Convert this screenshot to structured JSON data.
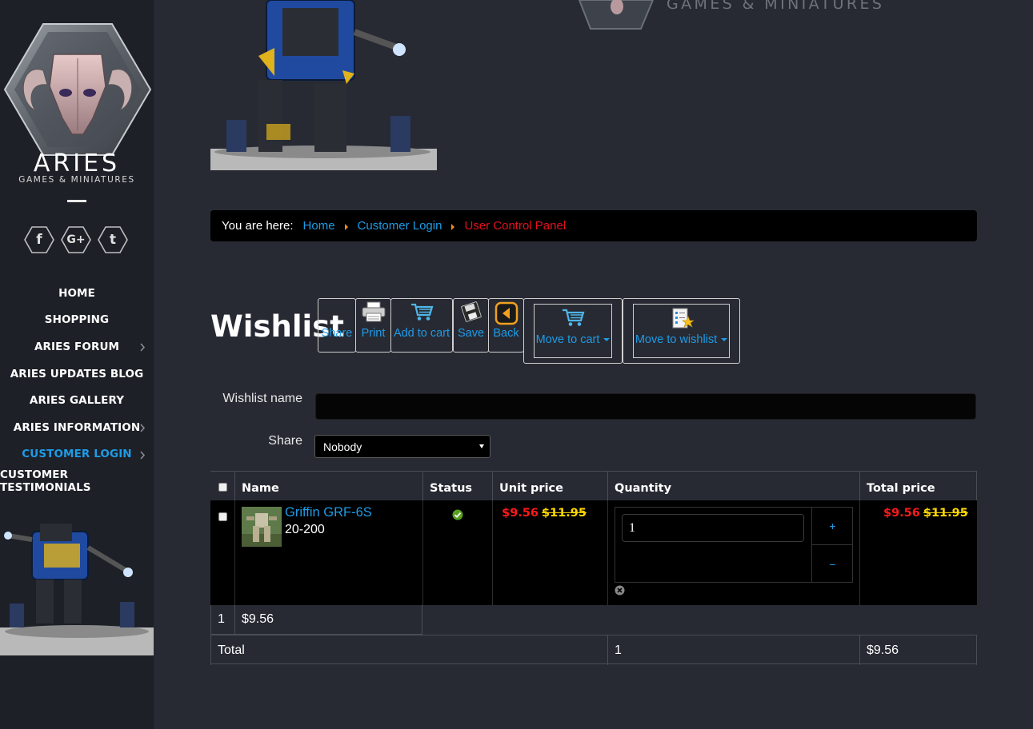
{
  "sidebar": {
    "logo_text": "ARIES",
    "logo_subtext": "GAMES & MINIATURES",
    "social": [
      {
        "icon": "facebook-icon",
        "glyph": "f"
      },
      {
        "icon": "google-plus-icon",
        "glyph": "G+"
      },
      {
        "icon": "tumblr-icon",
        "glyph": "t"
      }
    ],
    "nav": [
      {
        "label": "HOME"
      },
      {
        "label": "SHOPPING"
      },
      {
        "label": "ARIES FORUM"
      },
      {
        "label": "ARIES UPDATES BLOG"
      },
      {
        "label": "ARIES GALLERY"
      },
      {
        "label": "ARIES INFORMATION"
      },
      {
        "label": "CUSTOMER LOGIN"
      },
      {
        "label": "CUSTOMER TESTIMONIALS"
      }
    ]
  },
  "banner": {
    "logo_subtext": "GAMES & MINIATURES"
  },
  "breadcrumb": {
    "label": "You are here:",
    "items": [
      "Home",
      "Customer Login",
      "User Control Panel"
    ]
  },
  "page": {
    "title": "Wishlist"
  },
  "toolbar": {
    "share": "Share",
    "print": "Print",
    "add_to_cart": "Add to cart",
    "save": "Save",
    "back": "Back",
    "move_to_cart": "Move to cart",
    "move_to_wishlist": "Move to wishlist"
  },
  "form": {
    "name_label": "Wishlist name",
    "name_value": "",
    "share_label": "Share",
    "share_value": "Nobody"
  },
  "table": {
    "headers": {
      "name": "Name",
      "status": "Status",
      "unit_price": "Unit price",
      "quantity": "Quantity",
      "total_price": "Total price"
    },
    "rows": [
      {
        "name": "Griffin GRF-6S",
        "sku": "20-200",
        "status": "ok",
        "unit_price_new": "$9.56",
        "unit_price_old": "$11.95",
        "quantity": "1",
        "plus": "+",
        "minus": "−",
        "total_new": "$9.56",
        "total_old": "$11.95"
      }
    ],
    "subtotal": {
      "count": "1",
      "amount": "$9.56"
    },
    "total": {
      "label": "Total",
      "quantity": "1",
      "amount": "$9.56"
    }
  },
  "colors": {
    "accent": "#1e9be6",
    "active_crumb": "#e3101b",
    "price_new": "#ff1a1a",
    "price_old": "#ffd900",
    "sidebar_bg": "#1d2027",
    "page_bg": "#272a33"
  }
}
